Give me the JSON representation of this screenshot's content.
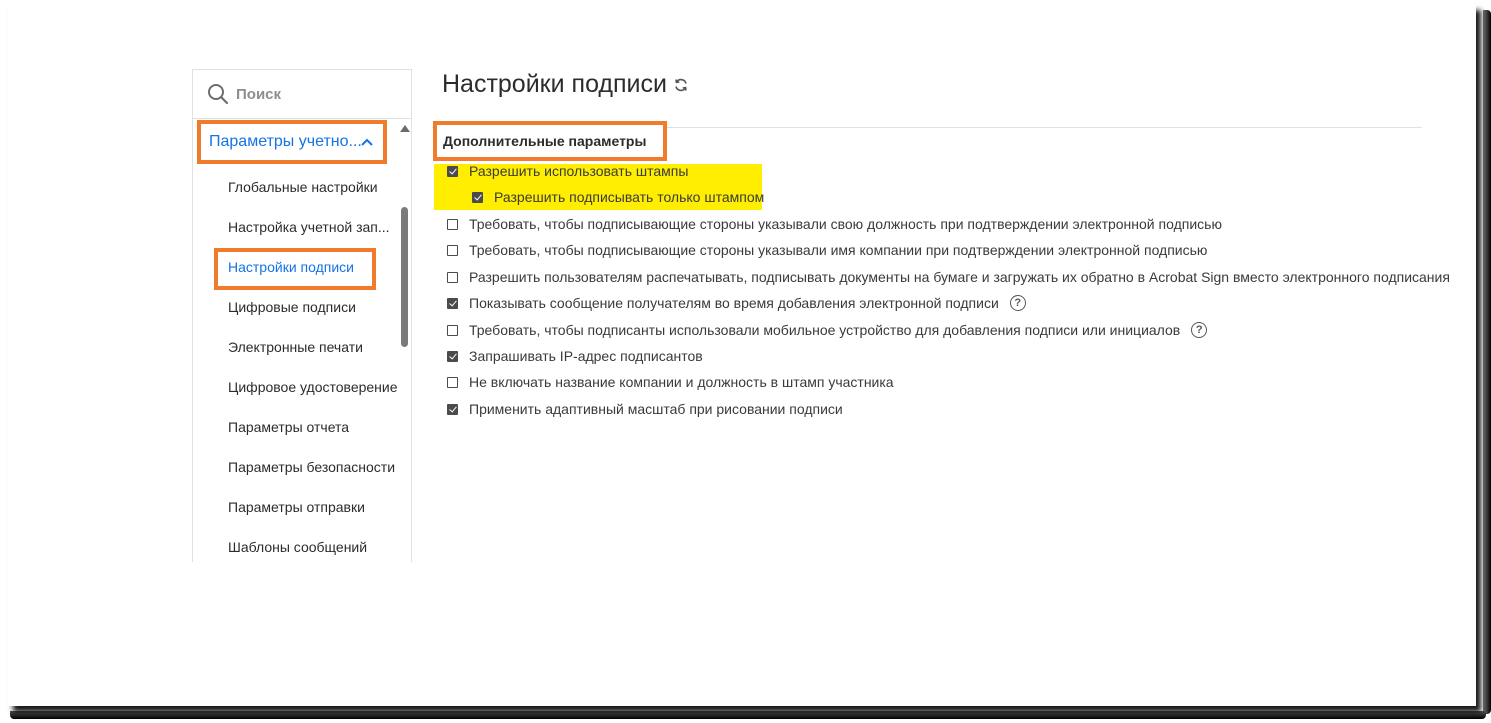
{
  "search": {
    "placeholder": "Поиск",
    "icon": "search-icon"
  },
  "sidebar": {
    "group_label": "Параметры учетно...",
    "items": [
      {
        "label": "Глобальные настройки",
        "active": false
      },
      {
        "label": "Настройка учетной зап...",
        "active": false
      },
      {
        "label": "Настройки подписи",
        "active": true
      },
      {
        "label": "Цифровые подписи",
        "active": false
      },
      {
        "label": "Электронные печати",
        "active": false
      },
      {
        "label": "Цифровое удостоверение",
        "active": false
      },
      {
        "label": "Параметры отчета",
        "active": false
      },
      {
        "label": "Параметры безопасности",
        "active": false
      },
      {
        "label": "Параметры отправки",
        "active": false
      },
      {
        "label": "Шаблоны сообщений",
        "active": false
      }
    ]
  },
  "main": {
    "title": "Настройки подписи",
    "section_title": "Дополнительные параметры",
    "options": [
      {
        "label": "Разрешить использовать штампы",
        "checked": true,
        "help": false
      },
      {
        "label": "Разрешить подписывать только штампом",
        "checked": true,
        "help": false
      },
      {
        "label": "Требовать, чтобы подписывающие стороны указывали свою должность при подтверждении электронной подписью",
        "checked": false,
        "help": false
      },
      {
        "label": "Требовать, чтобы подписывающие стороны указывали имя компании при подтверждении электронной подписью",
        "checked": false,
        "help": false
      },
      {
        "label": "Разрешить пользователям распечатывать, подписывать документы на бумаге и загружать их обратно в Acrobat Sign вместо электронного подписания",
        "checked": false,
        "help": false
      },
      {
        "label": "Показывать сообщение получателям во время добавления электронной подписи",
        "checked": true,
        "help": true
      },
      {
        "label": "Требовать, чтобы подписанты использовали мобильное устройство для добавления подписи или инициалов",
        "checked": false,
        "help": true
      },
      {
        "label": "Запрашивать IP-адрес подписантов",
        "checked": true,
        "help": false
      },
      {
        "label": "Не включать название компании и должность в штамп участника",
        "checked": false,
        "help": false
      },
      {
        "label": "Применить адаптивный масштаб при рисовании подписи",
        "checked": true,
        "help": false
      }
    ],
    "help_glyph": "?"
  },
  "colors": {
    "accent": "#1473e6",
    "callout": "#f07c2b",
    "highlight": "#ffee00"
  }
}
